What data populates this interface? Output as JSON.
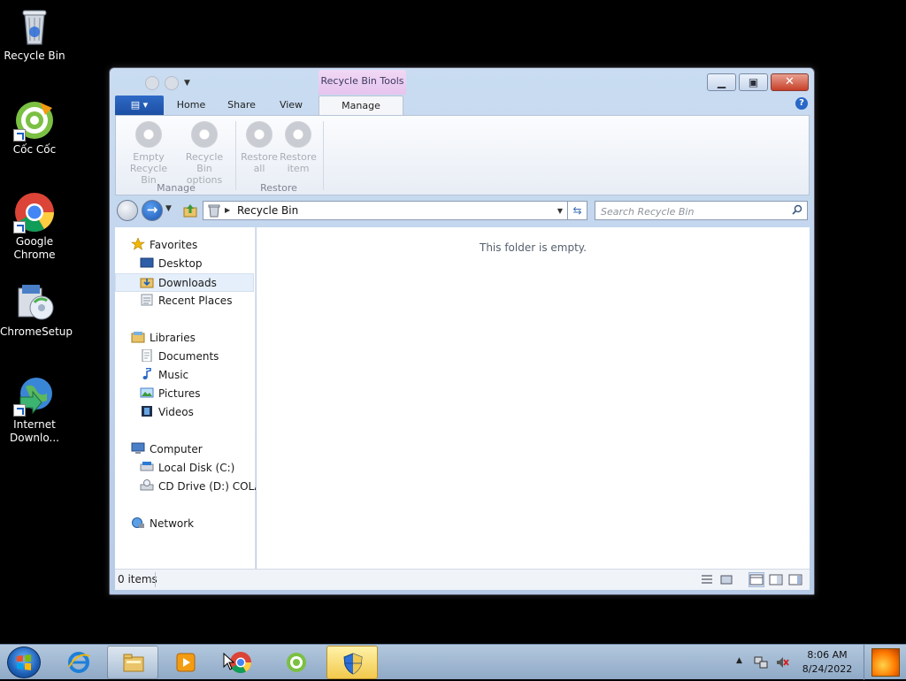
{
  "desktop": {
    "icons": [
      {
        "label": "Recycle Bin"
      },
      {
        "label": "Cốc Cốc"
      },
      {
        "label": "Google Chrome"
      },
      {
        "label": "ChromeSetup"
      },
      {
        "label": "Internet Downlo..."
      }
    ]
  },
  "window": {
    "contextual_tab": "Recycle Bin Tools",
    "ribbon_tabs": [
      "Home",
      "Share",
      "View",
      "Manage"
    ],
    "active_tab": "Manage",
    "ribbon": {
      "empty_label": "Empty Recycle Bin",
      "options_label": "Recycle Bin options",
      "group_manage": "Manage",
      "restore_all_label": "Restore all",
      "restore_item_label": "Restore item",
      "group_restore": "Restore"
    },
    "address": {
      "path": "Recycle Bin",
      "search_placeholder": "Search Recycle Bin"
    },
    "nav": {
      "favorites": "Favorites",
      "desktop": "Desktop",
      "downloads": "Downloads",
      "recent": "Recent Places",
      "libraries": "Libraries",
      "documents": "Documents",
      "music": "Music",
      "pictures": "Pictures",
      "videos": "Videos",
      "computer": "Computer",
      "local_disk": "Local Disk (C:)",
      "cd_drive": "CD Drive (D:) COLAB",
      "network": "Network"
    },
    "empty_message": "This folder is empty.",
    "status_count": "0 items"
  },
  "taskbar": {
    "time": "8:06 AM",
    "date": "8/24/2022"
  },
  "colors": {
    "accent": "#1c4fa3",
    "contextual": "#e6c4ee",
    "close": "#c7402a"
  }
}
